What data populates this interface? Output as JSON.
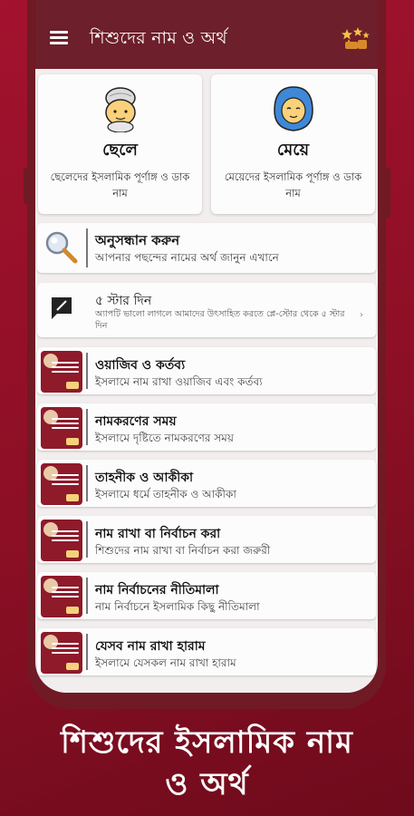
{
  "app_title": "শিশুদের নাম ও অর্থ",
  "cards": [
    {
      "title": "ছেলে",
      "desc": "ছেলেদের ইসলামিক পূর্ণাঙ্গ ও ডাক নাম"
    },
    {
      "title": "মেয়ে",
      "desc": "মেয়েদের ইসলামিক পূর্ণাঙ্গ ও ডাক নাম"
    }
  ],
  "search": {
    "title": "অনুসন্ধান করুন",
    "subtitle": "আপনার পছন্দের নামের অর্থ জানুন এখানে"
  },
  "rate": {
    "title": "৫ স্টার দিন",
    "subtitle": "অ্যাপটি ভালো লাগলে আমাদের উৎসাহিত করতে প্লে-স্টোর থেকে ৫ স্টার দিন"
  },
  "items": [
    {
      "title": "ওয়াজিব ও কর্তব্য",
      "subtitle": "ইসলামে নাম রাখা ওয়াজিব এবং কর্তব্য"
    },
    {
      "title": "নামকরণের সময়",
      "subtitle": "ইসলামে দৃষ্টিতে নামকরণের সময়"
    },
    {
      "title": "তাহনীক ও আকীকা",
      "subtitle": "ইসলামে ধর্মে তাহনীক ও আকীকা"
    },
    {
      "title": "নাম রাখা বা নির্বাচন করা",
      "subtitle": "শিশুদের নাম রাখা বা নির্বাচন করা জরুরী"
    },
    {
      "title": "নাম নির্বাচনের নীতিমালা",
      "subtitle": "নাম নির্বাচনে ইসলামিক কিছু নীতিমালা"
    },
    {
      "title": "যেসব নাম রাখা হারাম",
      "subtitle": "ইসলামে যেসকল নাম রাখা হারাম"
    }
  ],
  "bottom_title_line1": "শিশুদের ইসলামিক নাম",
  "bottom_title_line2": "ও অর্থ",
  "colors": {
    "appbar": "#6d1f2b",
    "background": "#a3122e",
    "screen": "#f2eeee"
  },
  "icons": [
    "menu-icon",
    "star-rating-icon",
    "boy-face-icon",
    "girl-face-icon",
    "search-icon",
    "feedback-icon",
    "chevron-right-icon"
  ]
}
